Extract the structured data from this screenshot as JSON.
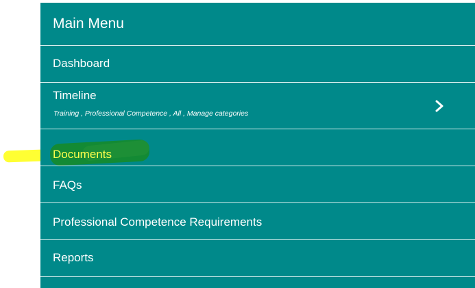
{
  "menu": {
    "title": "Main Menu",
    "items": [
      {
        "label": "Dashboard"
      },
      {
        "label": "Timeline",
        "subtitle": "Training , Professional Competence , All , Manage categories",
        "has_chevron": true
      },
      {
        "label": "Documents",
        "highlighted": true
      },
      {
        "label": "FAQs"
      },
      {
        "label": "Professional Competence Requirements"
      },
      {
        "label": "Reports"
      }
    ]
  },
  "colors": {
    "menu_background": "#00898a",
    "divider": "#d6eeee",
    "text": "#ffffff",
    "highlight_yellow": "#ffff33",
    "highlight_green": "#138a34",
    "highlighted_text": "#ffff4d"
  },
  "icons": {
    "timeline_chevron": "chevron-right-icon"
  }
}
